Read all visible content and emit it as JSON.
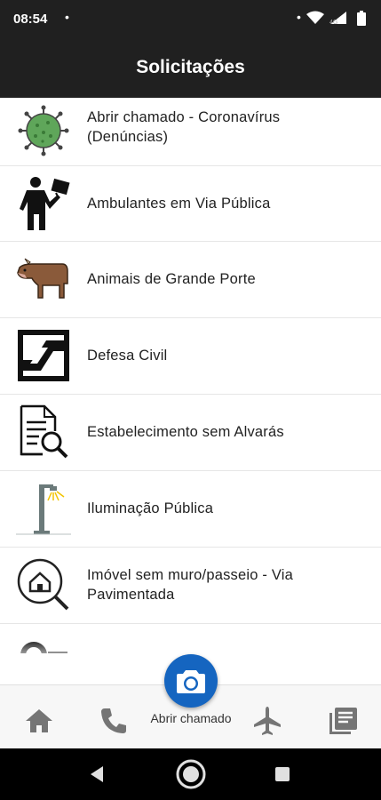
{
  "status_bar": {
    "time": "08:54",
    "notification_dot": "•",
    "icons": [
      "notification-dot",
      "wifi-icon",
      "signal-4g-icon",
      "battery-icon"
    ]
  },
  "app_bar": {
    "title": "Solicitações"
  },
  "list": {
    "items": [
      {
        "label": "Abrir chamado - Coronavírus (Denúncias)",
        "icon": "coronavirus-icon"
      },
      {
        "label": "Ambulantes em Via Pública",
        "icon": "street-vendor-icon"
      },
      {
        "label": "Animais de Grande Porte",
        "icon": "cow-icon"
      },
      {
        "label": "Defesa Civil",
        "icon": "civil-defense-logo-icon"
      },
      {
        "label": "Estabelecimento sem Alvarás",
        "icon": "document-search-icon"
      },
      {
        "label": "Iluminação Pública",
        "icon": "street-lamp-icon"
      },
      {
        "label": "Imóvel sem muro/passeio - Via Pavimentada",
        "icon": "house-search-icon"
      },
      {
        "label": "",
        "icon": "partial-icon"
      }
    ]
  },
  "bottom_nav": {
    "items": [
      {
        "name": "home",
        "icon": "home-icon"
      },
      {
        "name": "phone",
        "icon": "phone-icon"
      },
      {
        "name": "new-request",
        "icon": "camera-icon",
        "label": "Abrir chamado"
      },
      {
        "name": "flight",
        "icon": "airplane-icon"
      },
      {
        "name": "news",
        "icon": "library-books-icon"
      }
    ],
    "fab_color": "#1565c0"
  },
  "system_nav": {
    "icons": [
      "back-icon",
      "home-circle-icon",
      "recents-icon"
    ]
  },
  "colors": {
    "bar": "#202020",
    "accent": "#1565c0",
    "text": "#222222",
    "nav_icon": "#757575"
  }
}
